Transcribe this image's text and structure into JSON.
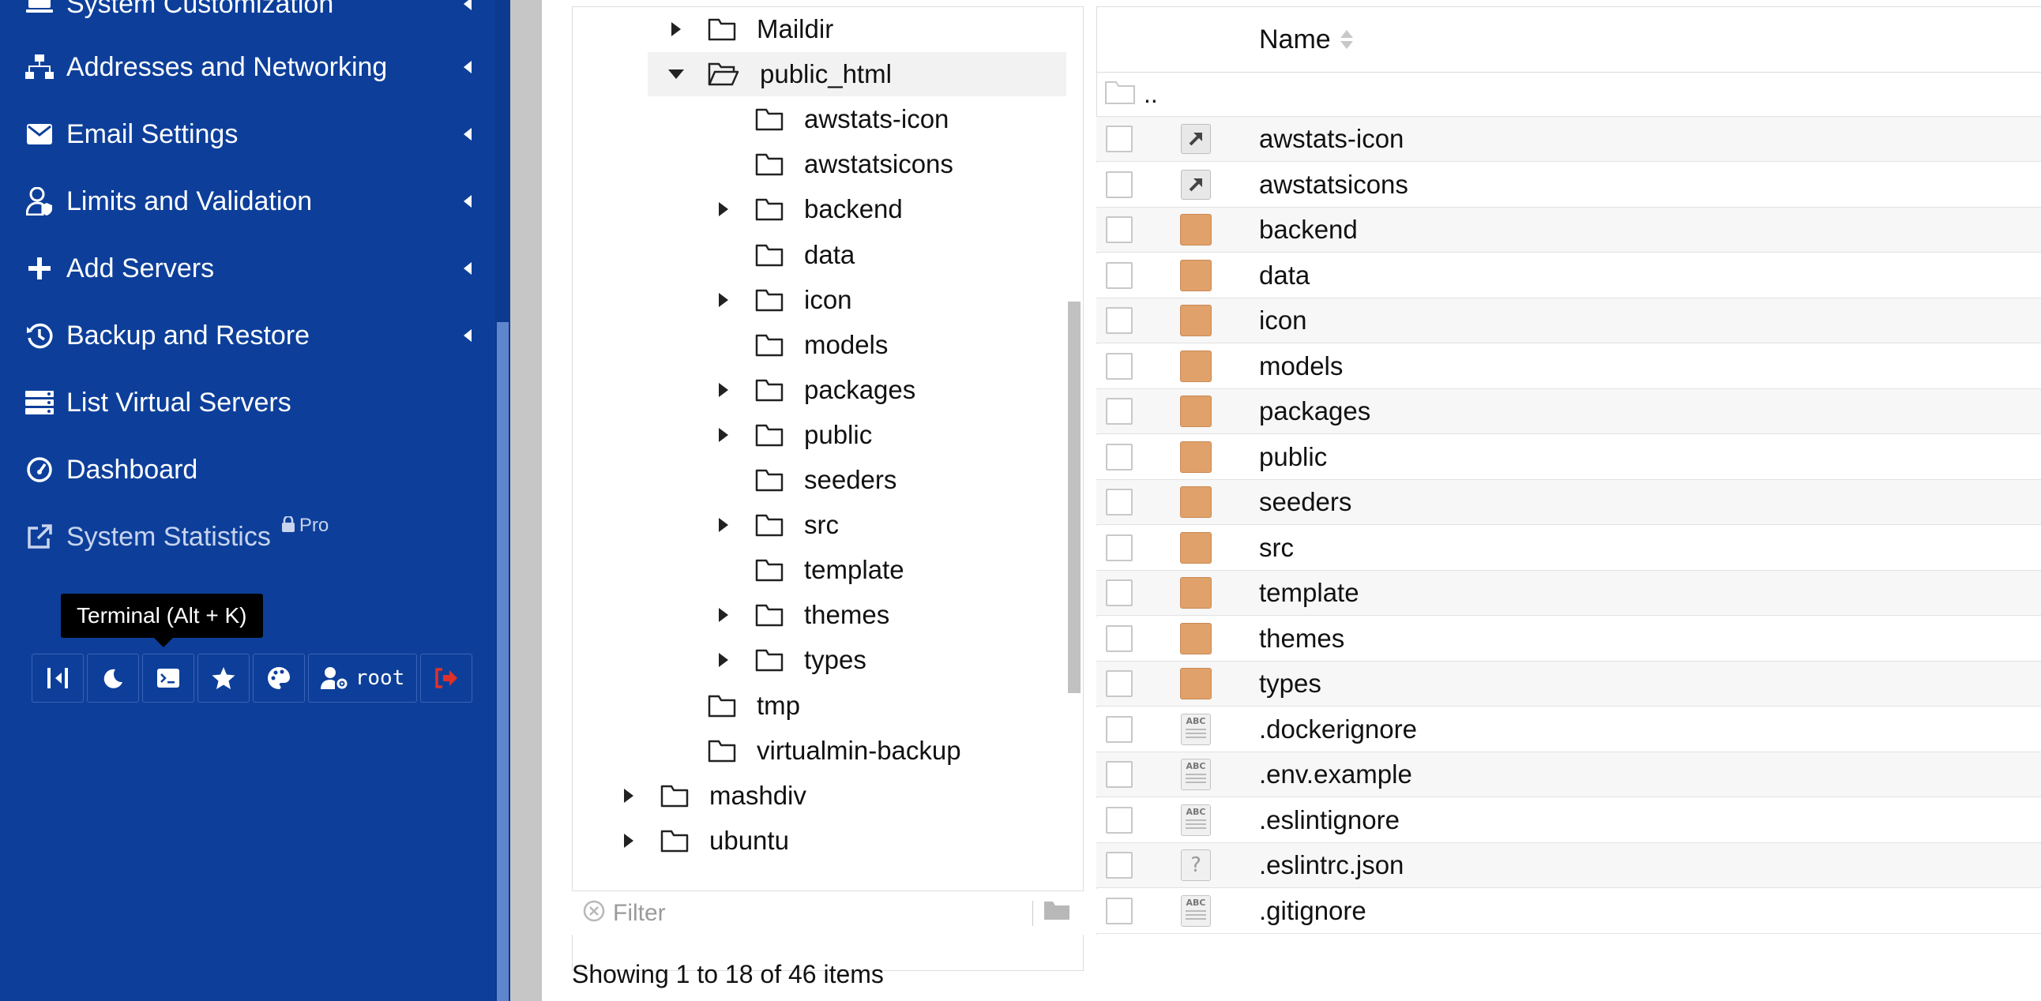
{
  "sidebar": {
    "menu": [
      {
        "label": "System Customization",
        "icon": "monitor-icon"
      },
      {
        "label": "Addresses and Networking",
        "icon": "network-icon"
      },
      {
        "label": "Email Settings",
        "icon": "envelope-icon"
      },
      {
        "label": "Limits and Validation",
        "icon": "user-shield-icon"
      },
      {
        "label": "Add Servers",
        "icon": "plus-icon"
      },
      {
        "label": "Backup and Restore",
        "icon": "history-icon"
      },
      {
        "label": "List Virtual Servers",
        "icon": "server-list-icon"
      },
      {
        "label": "Dashboard",
        "icon": "gauge-icon"
      },
      {
        "label": "System Statistics",
        "icon": "external-link-icon"
      }
    ],
    "pro_label": "Pro",
    "tooltip": "Terminal (Alt + K)",
    "toolbar": {
      "user": "root"
    }
  },
  "tree": {
    "items": [
      {
        "label": "Maildir",
        "expandable": true,
        "expanded": false,
        "depth": 2
      },
      {
        "label": "public_html",
        "expandable": true,
        "expanded": true,
        "depth": 2,
        "selected": true
      },
      {
        "label": "awstats-icon",
        "expandable": false,
        "depth": 3
      },
      {
        "label": "awstatsicons",
        "expandable": false,
        "depth": 3
      },
      {
        "label": "backend",
        "expandable": true,
        "expanded": false,
        "depth": 3
      },
      {
        "label": "data",
        "expandable": false,
        "depth": 3
      },
      {
        "label": "icon",
        "expandable": true,
        "expanded": false,
        "depth": 3
      },
      {
        "label": "models",
        "expandable": false,
        "depth": 3
      },
      {
        "label": "packages",
        "expandable": true,
        "expanded": false,
        "depth": 3
      },
      {
        "label": "public",
        "expandable": true,
        "expanded": false,
        "depth": 3
      },
      {
        "label": "seeders",
        "expandable": false,
        "depth": 3
      },
      {
        "label": "src",
        "expandable": true,
        "expanded": false,
        "depth": 3
      },
      {
        "label": "template",
        "expandable": false,
        "depth": 3
      },
      {
        "label": "themes",
        "expandable": true,
        "expanded": false,
        "depth": 3
      },
      {
        "label": "types",
        "expandable": true,
        "expanded": false,
        "depth": 3
      },
      {
        "label": "tmp",
        "expandable": false,
        "depth": 2
      },
      {
        "label": "virtualmin-backup",
        "expandable": false,
        "depth": 2
      },
      {
        "label": "mashdiv",
        "expandable": true,
        "expanded": false,
        "depth": 1
      },
      {
        "label": "ubuntu",
        "expandable": true,
        "expanded": false,
        "depth": 1
      }
    ],
    "filter_placeholder": "Filter"
  },
  "files": {
    "column_name": "Name",
    "parent_label": "..",
    "rows": [
      {
        "name": "awstats-icon",
        "type": "link"
      },
      {
        "name": "awstatsicons",
        "type": "link"
      },
      {
        "name": "backend",
        "type": "folder"
      },
      {
        "name": "data",
        "type": "folder"
      },
      {
        "name": "icon",
        "type": "folder"
      },
      {
        "name": "models",
        "type": "folder"
      },
      {
        "name": "packages",
        "type": "folder"
      },
      {
        "name": "public",
        "type": "folder"
      },
      {
        "name": "seeders",
        "type": "folder"
      },
      {
        "name": "src",
        "type": "folder"
      },
      {
        "name": "template",
        "type": "folder"
      },
      {
        "name": "themes",
        "type": "folder"
      },
      {
        "name": "types",
        "type": "folder"
      },
      {
        "name": ".dockerignore",
        "type": "text"
      },
      {
        "name": ".env.example",
        "type": "text"
      },
      {
        "name": ".eslintignore",
        "type": "text"
      },
      {
        "name": ".eslintrc.json",
        "type": "unknown"
      },
      {
        "name": ".gitignore",
        "type": "text"
      }
    ]
  },
  "status": "Showing 1 to 18 of 46 items",
  "colors": {
    "sidebar_bg": "#0d3f9a",
    "folder": "#e0a16a",
    "logout": "#e0302a"
  }
}
